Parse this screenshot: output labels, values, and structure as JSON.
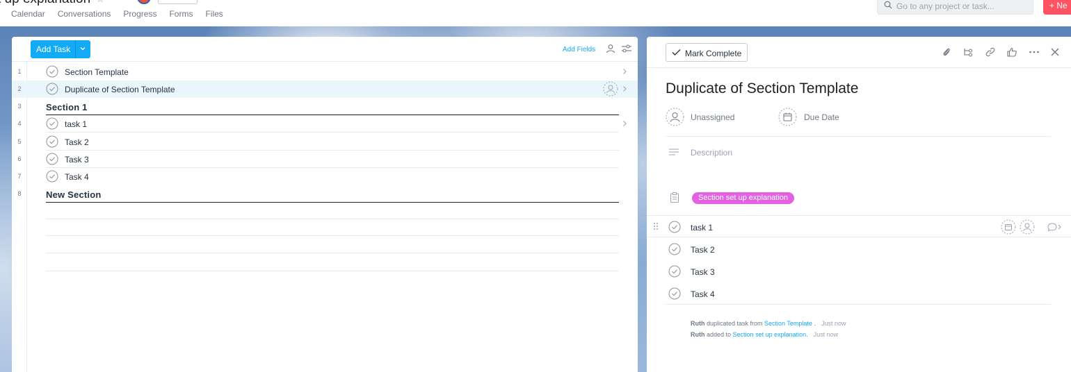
{
  "header": {
    "project_title": "t up explanation",
    "share_label": "",
    "tabs": [
      "Calendar",
      "Conversations",
      "Progress",
      "Forms",
      "Files"
    ],
    "search_placeholder": "Go to any project or task...",
    "new_label": "+ Ne"
  },
  "list": {
    "add_task_label": "Add Task",
    "add_fields_label": "Add Fields",
    "rows": [
      {
        "num": "1",
        "kind": "task",
        "name": "Section Template"
      },
      {
        "num": "2",
        "kind": "task",
        "name": "Duplicate of Section Template"
      },
      {
        "num": "3",
        "kind": "section",
        "name": "Section 1"
      },
      {
        "num": "4",
        "kind": "task",
        "name": "task 1"
      },
      {
        "num": "5",
        "kind": "task",
        "name": "Task 2"
      },
      {
        "num": "6",
        "kind": "task",
        "name": "Task 3"
      },
      {
        "num": "7",
        "kind": "task",
        "name": "Task 4"
      },
      {
        "num": "8",
        "kind": "section",
        "name": "New Section"
      }
    ]
  },
  "detail": {
    "mark_complete_label": "Mark Complete",
    "title": "Duplicate of Section Template",
    "assignee_label": "Unassigned",
    "due_date_label": "Due Date",
    "description_placeholder": "Description",
    "project_pill": "Section set up explanation",
    "subtasks": [
      "task 1",
      "Task 2",
      "Task 3",
      "Task 4"
    ],
    "stories": [
      {
        "who": "Ruth",
        "action": " duplicated task from ",
        "link": "Section Template",
        "tail": " .",
        "time": "Just now"
      },
      {
        "who": "Ruth",
        "action": " added to ",
        "link": "Section set up explanation",
        "tail": ".",
        "time": "Just now"
      }
    ]
  },
  "colors": {
    "accent": "#14aaf5",
    "new_button": "#ff5263",
    "project_pill": "#e362e3",
    "row_highlight": "#eaf5fc"
  }
}
